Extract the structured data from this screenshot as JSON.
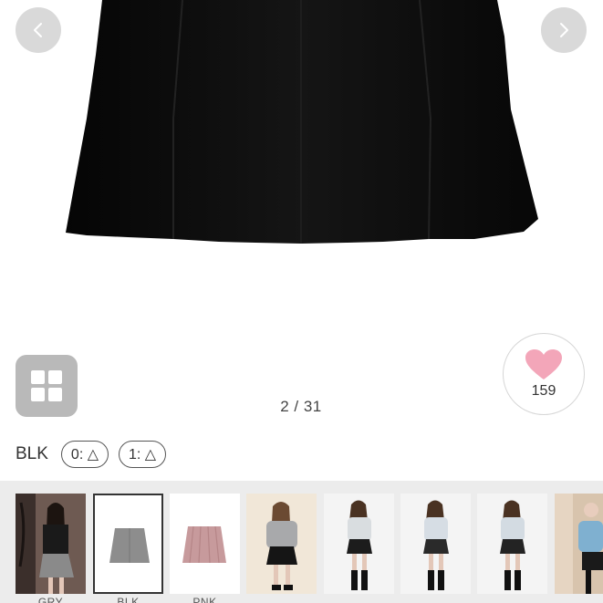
{
  "gallery": {
    "counter": "2 / 31",
    "prev_icon": "chevron-left-icon",
    "next_icon": "chevron-right-icon",
    "grid_icon": "grid-icon"
  },
  "like": {
    "icon": "heart-icon",
    "count": "159",
    "color": "#f3a6b9"
  },
  "variant": {
    "color_name": "BLK",
    "stock": [
      "0: △",
      "1: △"
    ]
  },
  "thumbnails": [
    {
      "label": "GRY",
      "kind": "model-photo"
    },
    {
      "label": "BLK",
      "kind": "skirt-gray",
      "selected": true
    },
    {
      "label": "PNK",
      "kind": "skirt-pink"
    },
    {
      "label": "",
      "kind": "model-photo"
    },
    {
      "label": "",
      "kind": "model-photo"
    },
    {
      "label": "",
      "kind": "model-photo"
    },
    {
      "label": "",
      "kind": "model-photo"
    },
    {
      "label": "",
      "kind": "model-photo"
    }
  ],
  "colors": {
    "skirt": "#0d0d0d",
    "nav_bg": "#d2d2d2",
    "grid_bg": "#b9b9b9",
    "strip_bg": "#ececec",
    "heart": "#f3a6b9"
  }
}
